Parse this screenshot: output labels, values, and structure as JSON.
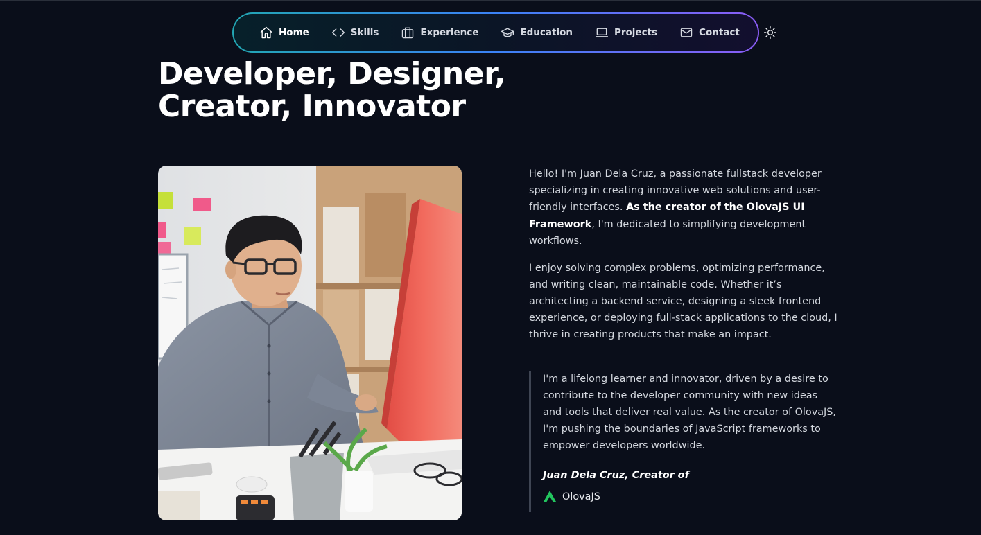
{
  "nav": {
    "items": [
      {
        "label": "Home",
        "icon": "home-icon",
        "active": true
      },
      {
        "label": "Skills",
        "icon": "code-icon"
      },
      {
        "label": "Experience",
        "icon": "briefcase-icon"
      },
      {
        "label": "Education",
        "icon": "graduation-cap-icon"
      },
      {
        "label": "Projects",
        "icon": "laptop-icon"
      },
      {
        "label": "Contact",
        "icon": "mail-icon"
      }
    ],
    "theme_toggle_icon": "sun-icon"
  },
  "hero": {
    "headline_line1": "Developer, Designer,",
    "headline_line2": "Creator, Innovator"
  },
  "bio": {
    "p1_start": "Hello! I'm Juan Dela Cruz, a passionate fullstack developer specializing in creating innovative web solutions and user-friendly interfaces. ",
    "p1_bold": "As the creator of the OlovaJS UI Framework",
    "p1_end": ", I'm dedicated to simplifying development workflows.",
    "p2": "I enjoy solving complex problems, optimizing performance, and writing clean, maintainable code. Whether it’s architecting a backend service, designing a sleek frontend experience, or deploying full-stack applications to the cloud, I thrive in creating products that make an impact."
  },
  "quote": {
    "text": "I'm a lifelong learner and innovator, driven by a desire to contribute to the developer community with new ideas and tools that deliver real value. As the creator of OlovaJS, I'm pushing the boundaries of JavaScript frameworks to empower developers worldwide.",
    "author": "Juan Dela Cruz, Creator of",
    "brand": "OlovaJS",
    "brand_icon": "olovajs-logo-icon"
  },
  "colors": {
    "background": "#0a0e1a",
    "nav_gradient_start": "#22a6b3",
    "nav_gradient_end": "#8b5cf6",
    "brand_green": "#22c55e",
    "monitor_red": "#f26b5e"
  }
}
